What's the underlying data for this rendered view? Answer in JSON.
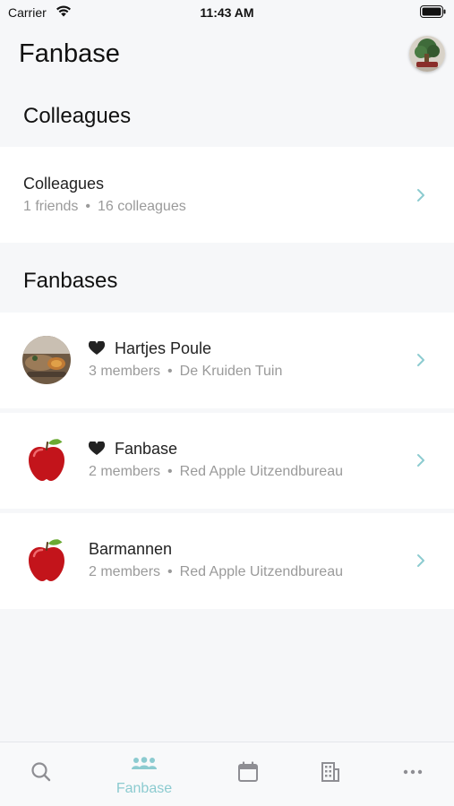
{
  "status_bar": {
    "carrier": "Carrier",
    "time": "11:43 AM"
  },
  "header": {
    "title": "Fanbase"
  },
  "colleagues_section": {
    "heading": "Colleagues",
    "row": {
      "title": "Colleagues",
      "friends": "1 friends",
      "colleagues": "16 colleagues"
    }
  },
  "fanbases_section": {
    "heading": "Fanbases",
    "items": [
      {
        "name": "Hartjes Poule",
        "members": "3 members",
        "company": "De Kruiden Tuin",
        "favorite": true,
        "thumb": "food-photo"
      },
      {
        "name": "Fanbase",
        "members": "2 members",
        "company": "Red Apple Uitzendbureau",
        "favorite": true,
        "thumb": "apple-logo"
      },
      {
        "name": "Barmannen",
        "members": "2 members",
        "company": "Red Apple Uitzendbureau",
        "favorite": false,
        "thumb": "apple-logo"
      }
    ]
  },
  "tab_bar": {
    "active_tab": "Fanbase",
    "tabs": [
      {
        "icon": "search-icon"
      },
      {
        "icon": "people-icon",
        "label": "Fanbase"
      },
      {
        "icon": "calendar-icon"
      },
      {
        "icon": "building-icon"
      },
      {
        "icon": "more-icon"
      }
    ]
  },
  "colors": {
    "accent": "#8ccbd0",
    "background": "#f6f7f9",
    "card": "#ffffff",
    "secondary_text": "#9a9a9a",
    "icon_gray": "#8e8e93"
  }
}
